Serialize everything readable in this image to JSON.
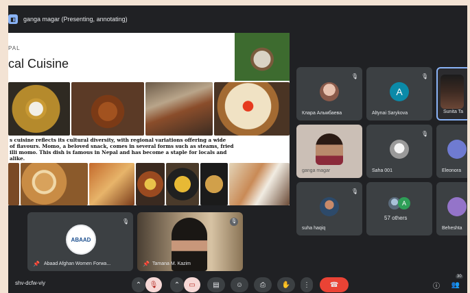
{
  "topbar": {
    "presenter_label": "ganga magar (Presenting, annotating)"
  },
  "slide": {
    "pretitle": "PAL",
    "title": "cal Cuisine",
    "text_lines": [
      "s cuisine reflects its cultural diversity, with regional variations offering a wide",
      "of flavours. Momo, a beloved snack, comes in several forms such as steams, fried",
      "illi momo. This dish is famous in Nepal and has become a staple for locals and",
      " alike."
    ]
  },
  "participants": [
    {
      "name": "Клара Альмбаева"
    },
    {
      "name": "Altynai Sarykova",
      "initial": "A",
      "avatar_color": "#0b8aa8"
    },
    {
      "name": "Sunita Ta"
    },
    {
      "name": "ganga magar"
    },
    {
      "name": "Saha 001"
    },
    {
      "name": "Eleonora"
    },
    {
      "name": "suha haqiq"
    },
    {
      "name": "57 others",
      "initial": "A",
      "avatar_color": "#2e9e57"
    },
    {
      "name": "Beheshta"
    },
    {
      "name": "Abaad Afghan Women Forwa...",
      "logo_text": "ABAAD"
    },
    {
      "name": "Tamana M. Kazim"
    }
  ],
  "bottombar": {
    "meeting_code": "shv-dcfw-viy",
    "people_count": "30"
  },
  "colors": {
    "background": "#202124",
    "tile": "#3c4043",
    "end_call": "#ea4335",
    "accent": "#8ab4f8"
  }
}
